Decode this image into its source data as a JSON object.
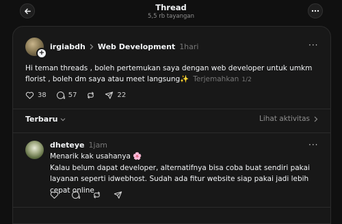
{
  "header": {
    "title": "Thread",
    "views": "5,5 rb tayangan"
  },
  "post": {
    "author": "irgiabdh",
    "community": "Web Development",
    "time": "1hari",
    "text": "Hi teman threads , boleh pertemukan saya dengan web developer untuk umkm florist , boleh dm saya atau meet langsung✨",
    "translate": "Terjemahkan",
    "pager": "1/2",
    "likes": "38",
    "comments": "57",
    "shares": "22"
  },
  "sort": {
    "label": "Terbaru",
    "activity": "Lihat aktivitas"
  },
  "reply": {
    "author": "dheteye",
    "time": "1jam",
    "line1": "Menarik kak usahanya 🌸",
    "line2": "Kalau belum dapat developer, alternatifnya bisa coba buat sendiri pakai layanan seperti idwebhost. Sudah ada fitur website siap pakai jadi lebih cepat online"
  }
}
